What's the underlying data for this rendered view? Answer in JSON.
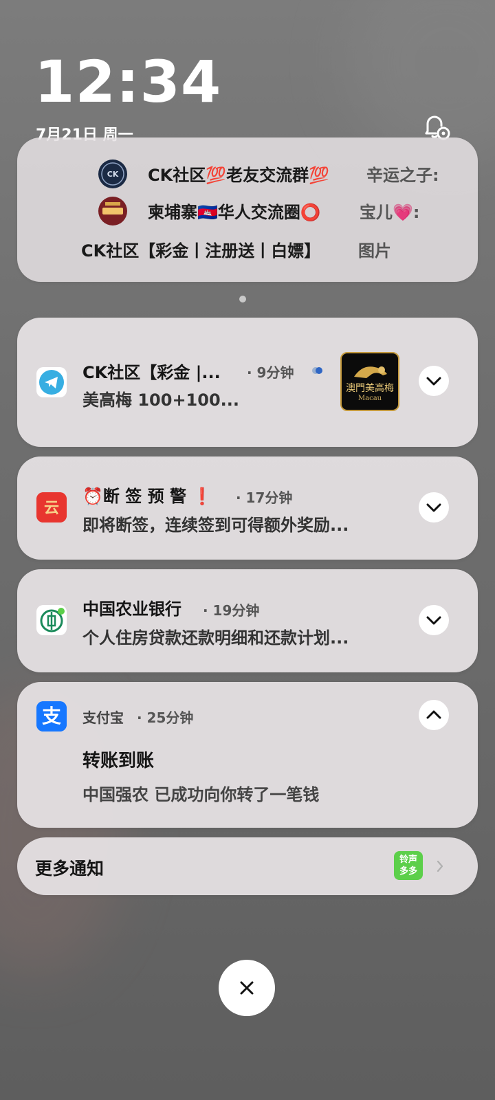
{
  "status": {
    "time": "12:34",
    "date": "7月21日 周一"
  },
  "grouped": {
    "rows": [
      {
        "name": "CK社区💯老友交流群💯",
        "sender": "辛运之子:"
      },
      {
        "name": "柬埔寨🇰🇭华人交流圈⭕",
        "sender": "宝儿💗:"
      }
    ],
    "title": "CK社区【彩金丨注册送丨白嫖】",
    "tail": "图片"
  },
  "notifications": [
    {
      "app": "telegram",
      "title": "CK社区【彩金 |...",
      "time": "· 9分钟",
      "body": "美高梅  100+100...",
      "thumb_top": "澳門美高梅",
      "thumb_bottom": "Macau"
    },
    {
      "app": "red-app",
      "title": "⏰断 签 预 警 ❗",
      "time": "· 17分钟",
      "body": "即将断签，连续签到可得额外奖励..."
    },
    {
      "app": "abc-bank",
      "title": "中国农业银行",
      "time": "· 19分钟",
      "body": "个人住房贷款还款明细和还款计划..."
    },
    {
      "app": "alipay",
      "title": "支付宝",
      "time": "· 25分钟",
      "headline": "转账到账",
      "body": "中国强农 已成功向你转了一笔钱",
      "icon_char": "支"
    }
  ],
  "more": {
    "label": "更多通知",
    "badge_line1": "铃声",
    "badge_line2": "多多"
  },
  "colors": {
    "card": "#e8e4e6",
    "telegram": "#37aee2",
    "alipay": "#1677ff",
    "abc_green": "#1a8a5a",
    "red_app": "#e8352f",
    "badge_green": "#5ccf4a"
  }
}
